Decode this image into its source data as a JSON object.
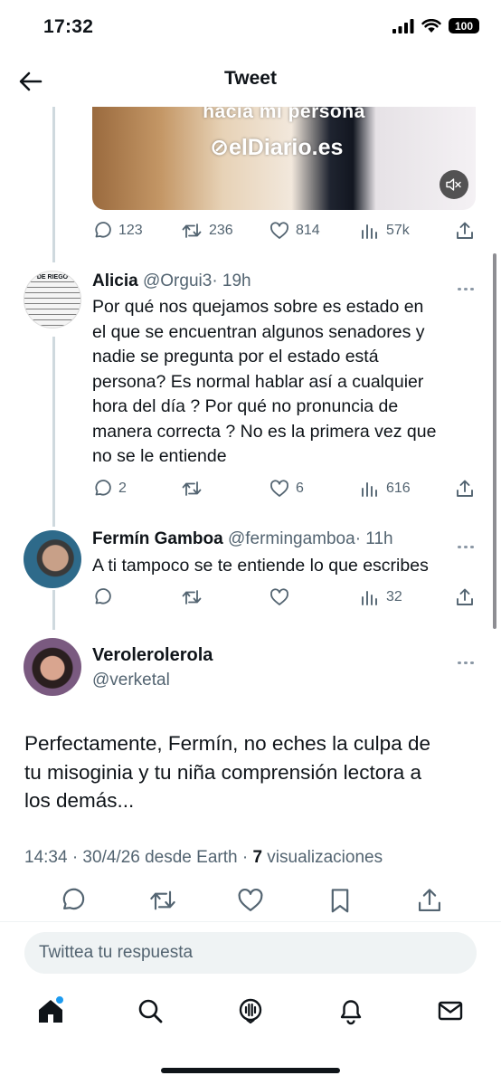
{
  "status_bar": {
    "time": "17:32",
    "battery": "100"
  },
  "header": {
    "title": "Tweet"
  },
  "media": {
    "caption": "hacia mi persona",
    "logo": "elDiario.es"
  },
  "quoted_tweet_stats": {
    "replies": "123",
    "retweets": "236",
    "likes": "814",
    "views": "57k"
  },
  "replies": [
    {
      "name": "Alicia",
      "handle": "@Orgui3",
      "time": "· 19h",
      "avatar_text": "DE RIEGO",
      "text_lines": [
        "Por qué nos quejamos sobre es estado en",
        "el que se encuentran algunos senadores y",
        "nadie se pregunta por el estado está",
        "persona? Es normal hablar así a cualquier",
        "hora del día ? Por qué no pronuncia de",
        "manera correcta ? No es la primera vez que",
        "no se le entiende"
      ],
      "stats": {
        "replies": "2",
        "retweets": "",
        "likes": "6",
        "views": "616"
      }
    },
    {
      "name": "Fermín Gamboa",
      "handle": "@fermingamboa",
      "time": "· 11h",
      "text_lines": [
        "A ti tampoco se te entiende lo que escribes"
      ],
      "stats": {
        "replies": "",
        "retweets": "",
        "likes": "",
        "views": "32"
      }
    }
  ],
  "main_tweet": {
    "name": "Verolerolerola",
    "handle": "@verketal",
    "text_lines": [
      "Perfectamente, Fermín, no eches la culpa de",
      "tu misoginia y tu niña comprensión lectora a",
      "los demás..."
    ],
    "meta_prefix": "14:34 · 30/4/26 desde Earth · ",
    "views_count": "7",
    "views_label": " visualizaciones"
  },
  "reply_box": {
    "placeholder": "Twittea tu respuesta"
  },
  "tab_bar": {
    "items": [
      "home-icon",
      "search-icon",
      "spaces-icon",
      "notifications-icon",
      "messages-icon"
    ]
  },
  "colors": {
    "accent": "#1d9bf0",
    "muted": "#536471",
    "text": "#0f1419"
  }
}
